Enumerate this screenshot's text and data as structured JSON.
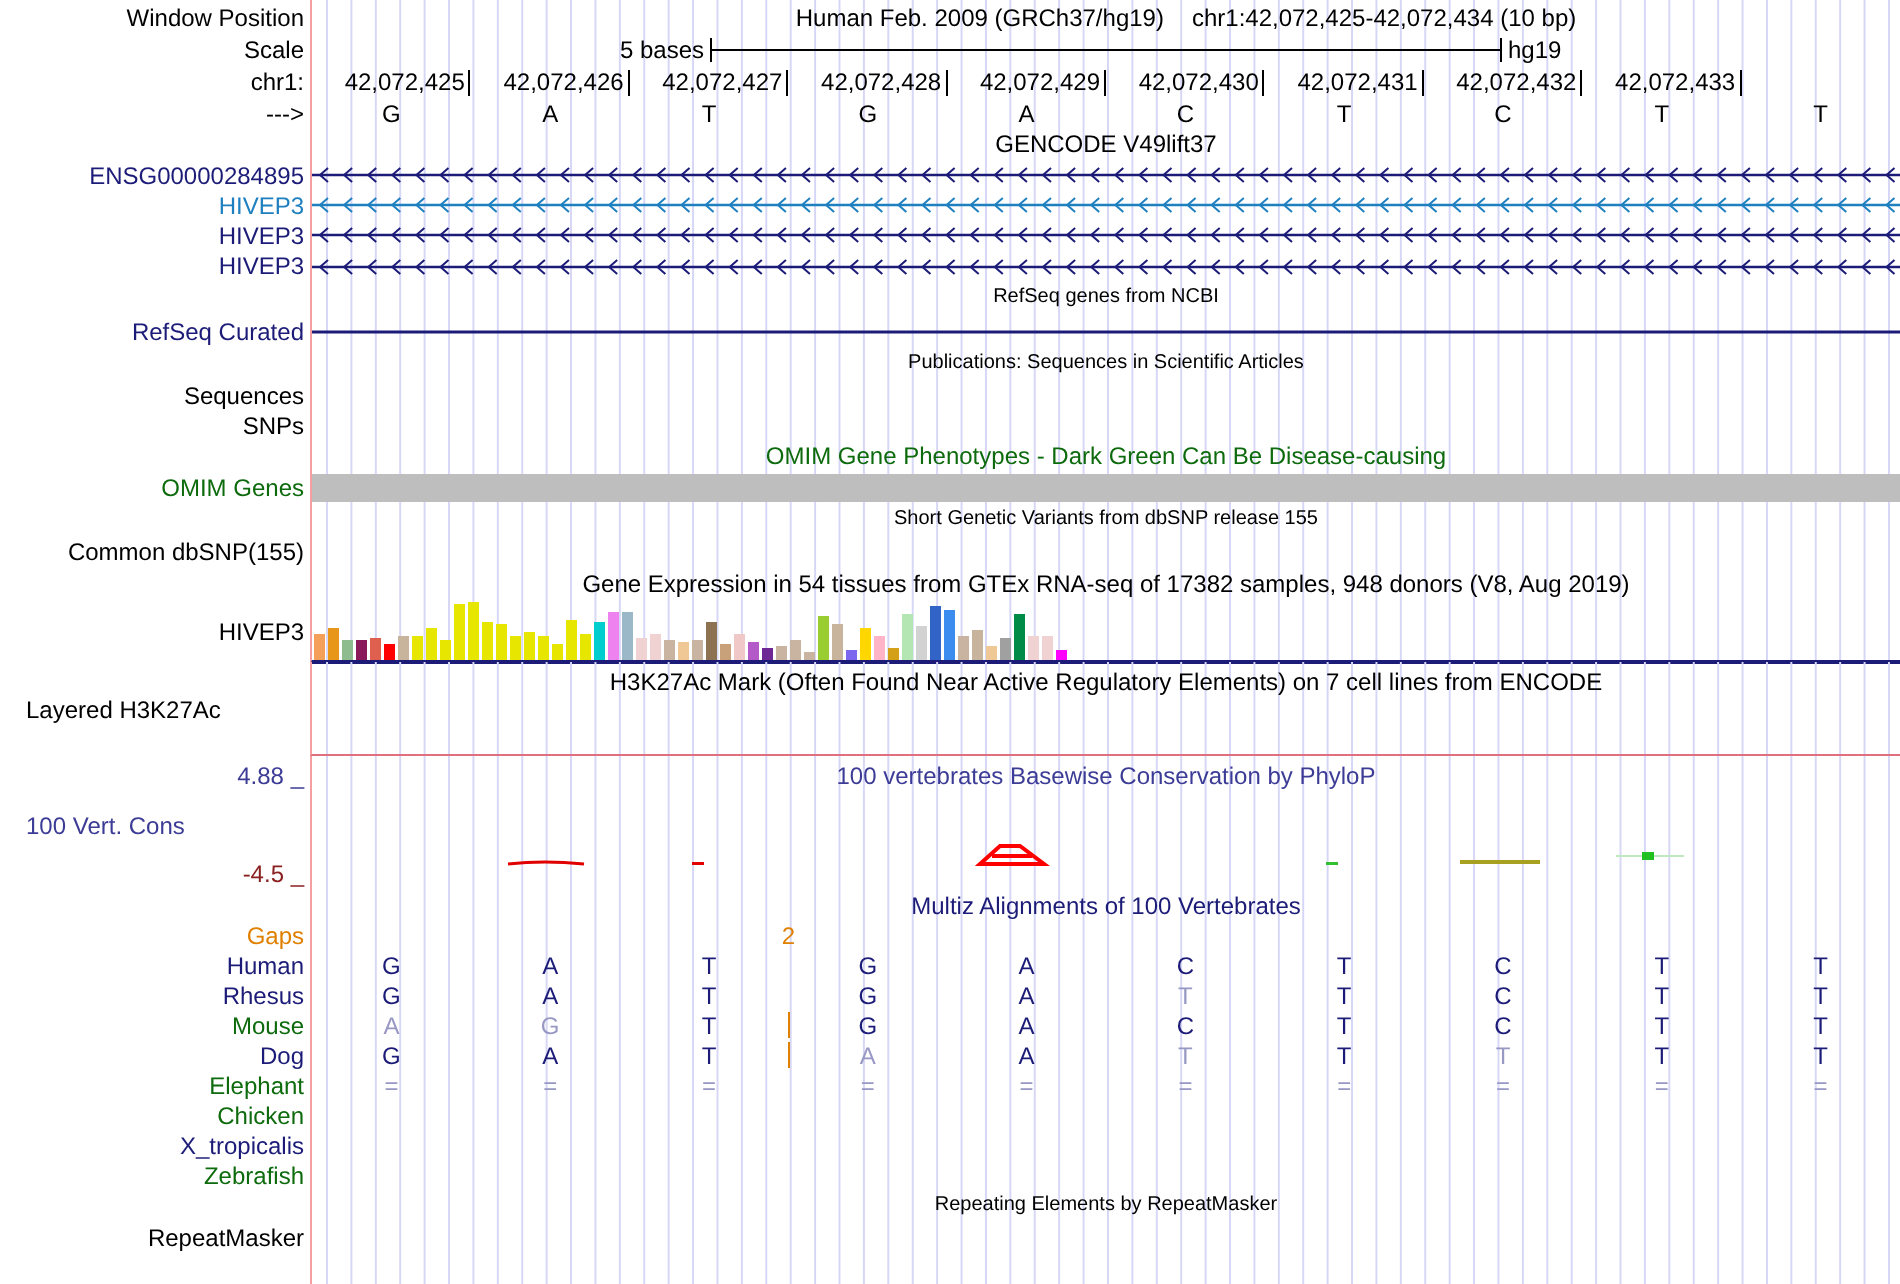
{
  "position": {
    "label": "Window Position",
    "assembly": "Human Feb. 2009 (GRCh37/hg19)",
    "range": "chr1:42,072,425-42,072,434 (10 bp)"
  },
  "scale": {
    "label": "Scale",
    "span": "5 bases",
    "db": "hg19"
  },
  "coordinates": {
    "label": "chr1:",
    "positions": [
      "42,072,425",
      "42,072,426",
      "42,072,427",
      "42,072,428",
      "42,072,429",
      "42,072,430",
      "42,072,431",
      "42,072,432",
      "42,072,433"
    ]
  },
  "strand": {
    "label": "--->",
    "bases": [
      "G",
      "A",
      "T",
      "G",
      "A",
      "C",
      "T",
      "C",
      "T",
      "T"
    ]
  },
  "tracks": [
    {
      "kind": "gene_set",
      "title": "GENCODE V49lift37",
      "genes": [
        {
          "name": "ENSG00000284895",
          "color": "#1c1c78"
        },
        {
          "name": "HIVEP3",
          "color": "#1f80c0"
        },
        {
          "name": "HIVEP3",
          "color": "#1c1c78"
        },
        {
          "name": "HIVEP3",
          "color": "#1c1c78"
        }
      ]
    },
    {
      "kind": "refseq",
      "title": "RefSeq genes from NCBI",
      "label": "RefSeq Curated"
    },
    {
      "kind": "empty",
      "title": "Publications: Sequences in Scientific Articles",
      "labels": [
        "Sequences",
        "SNPs"
      ]
    },
    {
      "kind": "omim",
      "title": "OMIM Gene Phenotypes - Dark Green Can Be Disease-causing",
      "label": "OMIM Genes"
    },
    {
      "kind": "empty",
      "title": "Short Genetic Variants from dbSNP release 155",
      "labels": [
        "Common dbSNP(155)"
      ]
    },
    {
      "kind": "expression",
      "title": "Gene Expression in 54 tissues from GTEx RNA-seq of 17382 samples, 948 donors (V8, Aug 2019)",
      "label": "HIVEP3"
    },
    {
      "kind": "signal",
      "title": "H3K27Ac Mark (Often Found Near Active Regulatory Elements) on 7 cell lines from ENCODE",
      "label": "Layered H3K27Ac"
    },
    {
      "kind": "conservation",
      "title": "100 vertebrates Basewise Conservation by PhyloP",
      "label": "100 Vert. Cons",
      "max": "4.88 _",
      "min": "-4.5 _"
    },
    {
      "kind": "alignment",
      "title": "Multiz Alignments of 100 Vertebrates",
      "gaps": {
        "label": "Gaps",
        "text": "2"
      },
      "species": [
        {
          "name": "Human",
          "color": "#1c1c78",
          "insertion": false,
          "bases": [
            {
              "text": "G",
              "mismatch": false
            },
            {
              "text": "A",
              "mismatch": false
            },
            {
              "text": "T",
              "mismatch": false
            },
            {
              "text": "G",
              "mismatch": false
            },
            {
              "text": "A",
              "mismatch": false
            },
            {
              "text": "C",
              "mismatch": false
            },
            {
              "text": "T",
              "mismatch": false
            },
            {
              "text": "C",
              "mismatch": false
            },
            {
              "text": "T",
              "mismatch": false
            },
            {
              "text": "T",
              "mismatch": false
            }
          ]
        },
        {
          "name": "Rhesus",
          "color": "#1c1c78",
          "insertion": false,
          "bases": [
            {
              "text": "G",
              "mismatch": false
            },
            {
              "text": "A",
              "mismatch": false
            },
            {
              "text": "T",
              "mismatch": false
            },
            {
              "text": "G",
              "mismatch": false
            },
            {
              "text": "A",
              "mismatch": false
            },
            {
              "text": "T",
              "mismatch": true
            },
            {
              "text": "T",
              "mismatch": false
            },
            {
              "text": "C",
              "mismatch": false
            },
            {
              "text": "T",
              "mismatch": false
            },
            {
              "text": "T",
              "mismatch": false
            }
          ]
        },
        {
          "name": "Mouse",
          "color": "#0d6b0d",
          "insertion": true,
          "bases": [
            {
              "text": "A",
              "mismatch": true
            },
            {
              "text": "G",
              "mismatch": true
            },
            {
              "text": "T",
              "mismatch": false
            },
            {
              "text": "G",
              "mismatch": false
            },
            {
              "text": "A",
              "mismatch": false
            },
            {
              "text": "C",
              "mismatch": false
            },
            {
              "text": "T",
              "mismatch": false
            },
            {
              "text": "C",
              "mismatch": false
            },
            {
              "text": "T",
              "mismatch": false
            },
            {
              "text": "T",
              "mismatch": false
            }
          ]
        },
        {
          "name": "Dog",
          "color": "#1c1c78",
          "insertion": true,
          "bases": [
            {
              "text": "G",
              "mismatch": false
            },
            {
              "text": "A",
              "mismatch": false
            },
            {
              "text": "T",
              "mismatch": false
            },
            {
              "text": "A",
              "mismatch": true
            },
            {
              "text": "A",
              "mismatch": false
            },
            {
              "text": "T",
              "mismatch": true
            },
            {
              "text": "T",
              "mismatch": false
            },
            {
              "text": "T",
              "mismatch": true
            },
            {
              "text": "T",
              "mismatch": false
            },
            {
              "text": "T",
              "mismatch": false
            }
          ]
        },
        {
          "name": "Elephant",
          "color": "#0d6b0d",
          "insertion": false,
          "bases": [
            {
              "text": "=",
              "mismatch": true
            },
            {
              "text": "=",
              "mismatch": true
            },
            {
              "text": "=",
              "mismatch": true
            },
            {
              "text": "=",
              "mismatch": true
            },
            {
              "text": "=",
              "mismatch": true
            },
            {
              "text": "=",
              "mismatch": true
            },
            {
              "text": "=",
              "mismatch": true
            },
            {
              "text": "=",
              "mismatch": true
            },
            {
              "text": "=",
              "mismatch": true
            },
            {
              "text": "=",
              "mismatch": true
            }
          ]
        },
        {
          "name": "Chicken",
          "color": "#0d6b0d",
          "insertion": false
        },
        {
          "name": "X_tropicalis",
          "color": "#1c1c78",
          "insertion": false
        },
        {
          "name": "Zebrafish",
          "color": "#0d6b0d",
          "insertion": false
        }
      ]
    },
    {
      "kind": "empty",
      "title": "Repeating Elements by RepeatMasker",
      "labels": [
        "RepeatMasker"
      ]
    }
  ]
}
